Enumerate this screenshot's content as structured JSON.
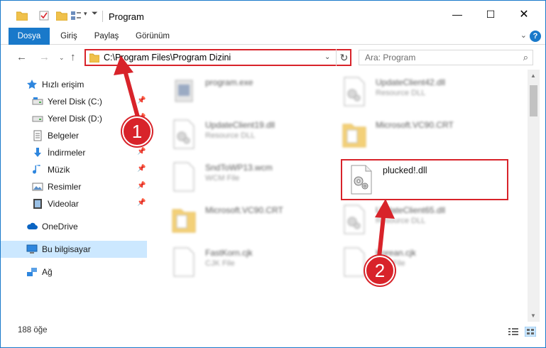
{
  "window": {
    "title": "Program"
  },
  "ribbon": {
    "tabs": [
      "Dosya",
      "Giriş",
      "Paylaş",
      "Görünüm"
    ]
  },
  "address": {
    "path": "C:\\Program Files\\Program Dizini"
  },
  "search": {
    "placeholder": "Ara: Program"
  },
  "navpane": {
    "items": [
      {
        "label": "Hızlı erişim",
        "icon": "star-icon"
      },
      {
        "label": "Yerel Disk (C:)",
        "icon": "drive-icon"
      },
      {
        "label": "Yerel Disk (D:)",
        "icon": "drive-icon"
      },
      {
        "label": "Belgeler",
        "icon": "documents-icon"
      },
      {
        "label": "İndirmeler",
        "icon": "download-icon"
      },
      {
        "label": "Müzik",
        "icon": "music-icon"
      },
      {
        "label": "Resimler",
        "icon": "pictures-icon"
      },
      {
        "label": "Videolar",
        "icon": "video-icon"
      },
      {
        "label": "OneDrive",
        "icon": "cloud-icon"
      },
      {
        "label": "Bu bilgisayar",
        "icon": "computer-icon"
      },
      {
        "label": "Ağ",
        "icon": "network-icon"
      }
    ]
  },
  "files": [
    {
      "name": "program.exe",
      "type": ""
    },
    {
      "name": "UpdateClient42.dll",
      "type": "Resource DLL"
    },
    {
      "name": "UpdateClient19.dll",
      "type": "Resource DLL"
    },
    {
      "name": "Microsoft.VC90.CRT",
      "type": ""
    },
    {
      "name": "SndToWP13.wcm",
      "type": "WCM File"
    },
    {
      "name": "plucked!.dll",
      "type": ""
    },
    {
      "name": "Microsoft.VC90.CRT",
      "type": ""
    },
    {
      "name": "UpdateClient65.dll",
      "type": "Resource DLL"
    },
    {
      "name": "FastKorn.cjk",
      "type": "CJK File"
    },
    {
      "name": "Korean.cjk",
      "type": "CJK File"
    }
  ],
  "status": {
    "count": "188 öğe"
  },
  "annotations": {
    "step1": "1",
    "step2": "2"
  },
  "colors": {
    "accent": "#1979ca",
    "highlight": "#d8232a",
    "selected": "#cce8ff"
  }
}
